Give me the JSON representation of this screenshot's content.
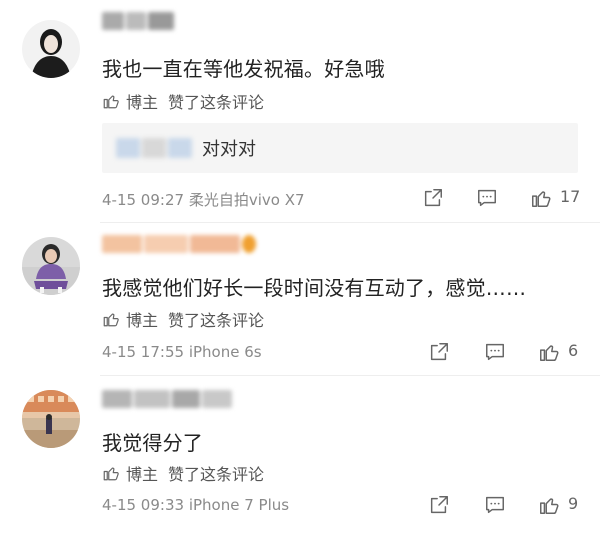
{
  "comments": [
    {
      "content": "我也一直在等他发祝福。好急哦",
      "host_label": "博主",
      "liked_label": "赞了这条评论",
      "reply": {
        "text": "对对对"
      },
      "date": "4-15 09:27",
      "source": "柔光自拍vivo X7",
      "likes": "17"
    },
    {
      "content": "我感觉他们好长一段时间没有互动了，感觉……",
      "host_label": "博主",
      "liked_label": "赞了这条评论",
      "date": "4-15 17:55",
      "source": "iPhone 6s",
      "likes": "6"
    },
    {
      "content": "我觉得分了",
      "host_label": "博主",
      "liked_label": "赞了这条评论",
      "date": "4-15 09:33",
      "source": "iPhone 7 Plus",
      "likes": "9"
    }
  ],
  "icons": {
    "share": "share-icon",
    "reply": "comment-icon",
    "like": "thumbs-up-icon"
  },
  "colors": {
    "text": "#222222",
    "meta": "#8a8a8a",
    "reply_bg": "#f5f5f5",
    "divider": "#eeeeee"
  }
}
